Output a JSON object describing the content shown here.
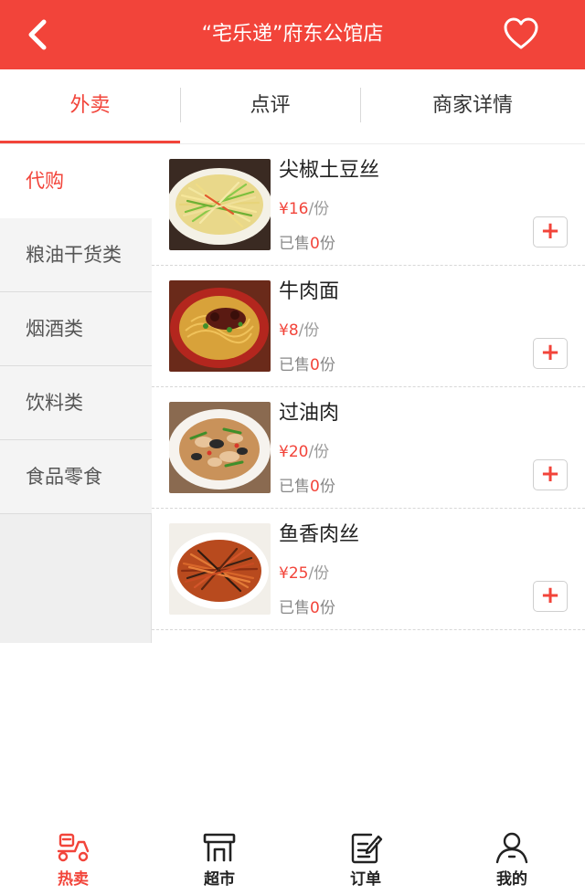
{
  "header": {
    "title": "“宅乐递”府东公馆店",
    "back_icon": "chevron-left-icon",
    "favorite_icon": "heart-outline-icon"
  },
  "tabs": [
    {
      "label": "外卖",
      "active": true
    },
    {
      "label": "点评",
      "active": false
    },
    {
      "label": "商家详情",
      "active": false
    }
  ],
  "sidebar": {
    "categories": [
      {
        "label": "代购",
        "active": true
      },
      {
        "label": "粮油干货类",
        "active": false
      },
      {
        "label": "烟酒类",
        "active": false
      },
      {
        "label": "饮料类",
        "active": false
      },
      {
        "label": "食品零食",
        "active": false
      }
    ]
  },
  "products": [
    {
      "name": "尖椒土豆丝",
      "price": "¥16",
      "unit": "/份",
      "sold_prefix": "已售",
      "sold_count": "0",
      "sold_suffix": "份",
      "add_label": "+"
    },
    {
      "name": "牛肉面",
      "price": "¥8",
      "unit": "/份",
      "sold_prefix": "已售",
      "sold_count": "0",
      "sold_suffix": "份",
      "add_label": "+"
    },
    {
      "name": "过油肉",
      "price": "¥20",
      "unit": "/份",
      "sold_prefix": "已售",
      "sold_count": "0",
      "sold_suffix": "份",
      "add_label": "+"
    },
    {
      "name": "鱼香肉丝",
      "price": "¥25",
      "unit": "/份",
      "sold_prefix": "已售",
      "sold_count": "0",
      "sold_suffix": "份",
      "add_label": "+"
    }
  ],
  "bottom_nav": [
    {
      "label": "热卖",
      "icon": "scooter-icon",
      "active": true
    },
    {
      "label": "超市",
      "icon": "shop-icon",
      "active": false
    },
    {
      "label": "订单",
      "icon": "order-icon",
      "active": false
    },
    {
      "label": "我的",
      "icon": "user-icon",
      "active": false
    }
  ],
  "colors": {
    "accent": "#f2443a",
    "header_bg": "#f2443a",
    "sidebar_bg": "#efefef"
  }
}
